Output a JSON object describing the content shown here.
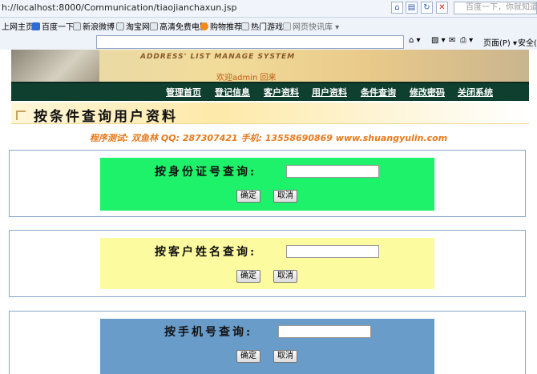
{
  "browser": {
    "url": "localhost:8000/Communication/tiaojianchaxun.jsp",
    "url_prefix": "h",
    "search_placeholder": "百度一下，你就知道",
    "favorites": [
      "上网主页",
      "百度一下",
      "新浪微博",
      "淘宝网",
      "高清免费电影",
      "购物推荐",
      "热门游戏",
      "网页快讯库 ▾"
    ],
    "commands": {
      "page": "页面(P) ▾",
      "safety": "安全(S"
    }
  },
  "site": {
    "banner_title": "ADDRESS' LIST MANAGE SYSTEM",
    "welcome": "欢迎admin 回来",
    "nav": [
      "管理首页",
      "登记信息",
      "客户资料",
      "用户资料",
      "条件查询",
      "修改密码",
      "关闭系统"
    ]
  },
  "page": {
    "title": "按条件查询用户资料",
    "credits": "程序测试: 双鱼林   QQ: 287307421   手机: 13558690869   www.shuangyulin.com"
  },
  "queries": [
    {
      "label": "按身份证号查询:",
      "value": "",
      "color": "#1ef26a",
      "ok": "确定",
      "cancel": "取消"
    },
    {
      "label": "按客户姓名查询:",
      "value": "",
      "color": "#fdfba0",
      "ok": "确定",
      "cancel": "取消"
    },
    {
      "label": "按手机号查询:",
      "value": "",
      "color": "#6a9cca",
      "ok": "确定",
      "cancel": "取消"
    }
  ]
}
